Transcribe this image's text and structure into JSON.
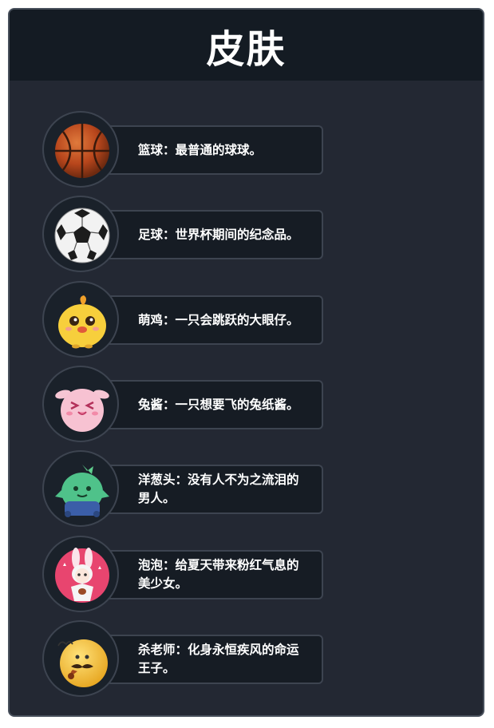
{
  "header": {
    "title": "皮肤"
  },
  "skins": [
    {
      "name": "篮球",
      "description": "篮球：最普通的球球。",
      "icon": "basketball-icon"
    },
    {
      "name": "足球",
      "description": "足球：世界杯期间的纪念品。",
      "icon": "soccer-ball-icon"
    },
    {
      "name": "萌鸡",
      "description": "萌鸡：一只会跳跃的大眼仔。",
      "icon": "cute-chick-icon"
    },
    {
      "name": "兔酱",
      "description": "兔酱：一只想要飞的兔纸酱。",
      "icon": "pink-bunny-icon"
    },
    {
      "name": "洋葱头",
      "description": "洋葱头：没有人不为之流泪的男人。",
      "icon": "onion-head-icon"
    },
    {
      "name": "泡泡",
      "description": "泡泡：给夏天带来粉红气息的美少女。",
      "icon": "bunny-girl-icon"
    },
    {
      "name": "杀老师",
      "description": "杀老师：化身永恒疾风的命运王子。",
      "icon": "mustache-ball-icon"
    }
  ]
}
